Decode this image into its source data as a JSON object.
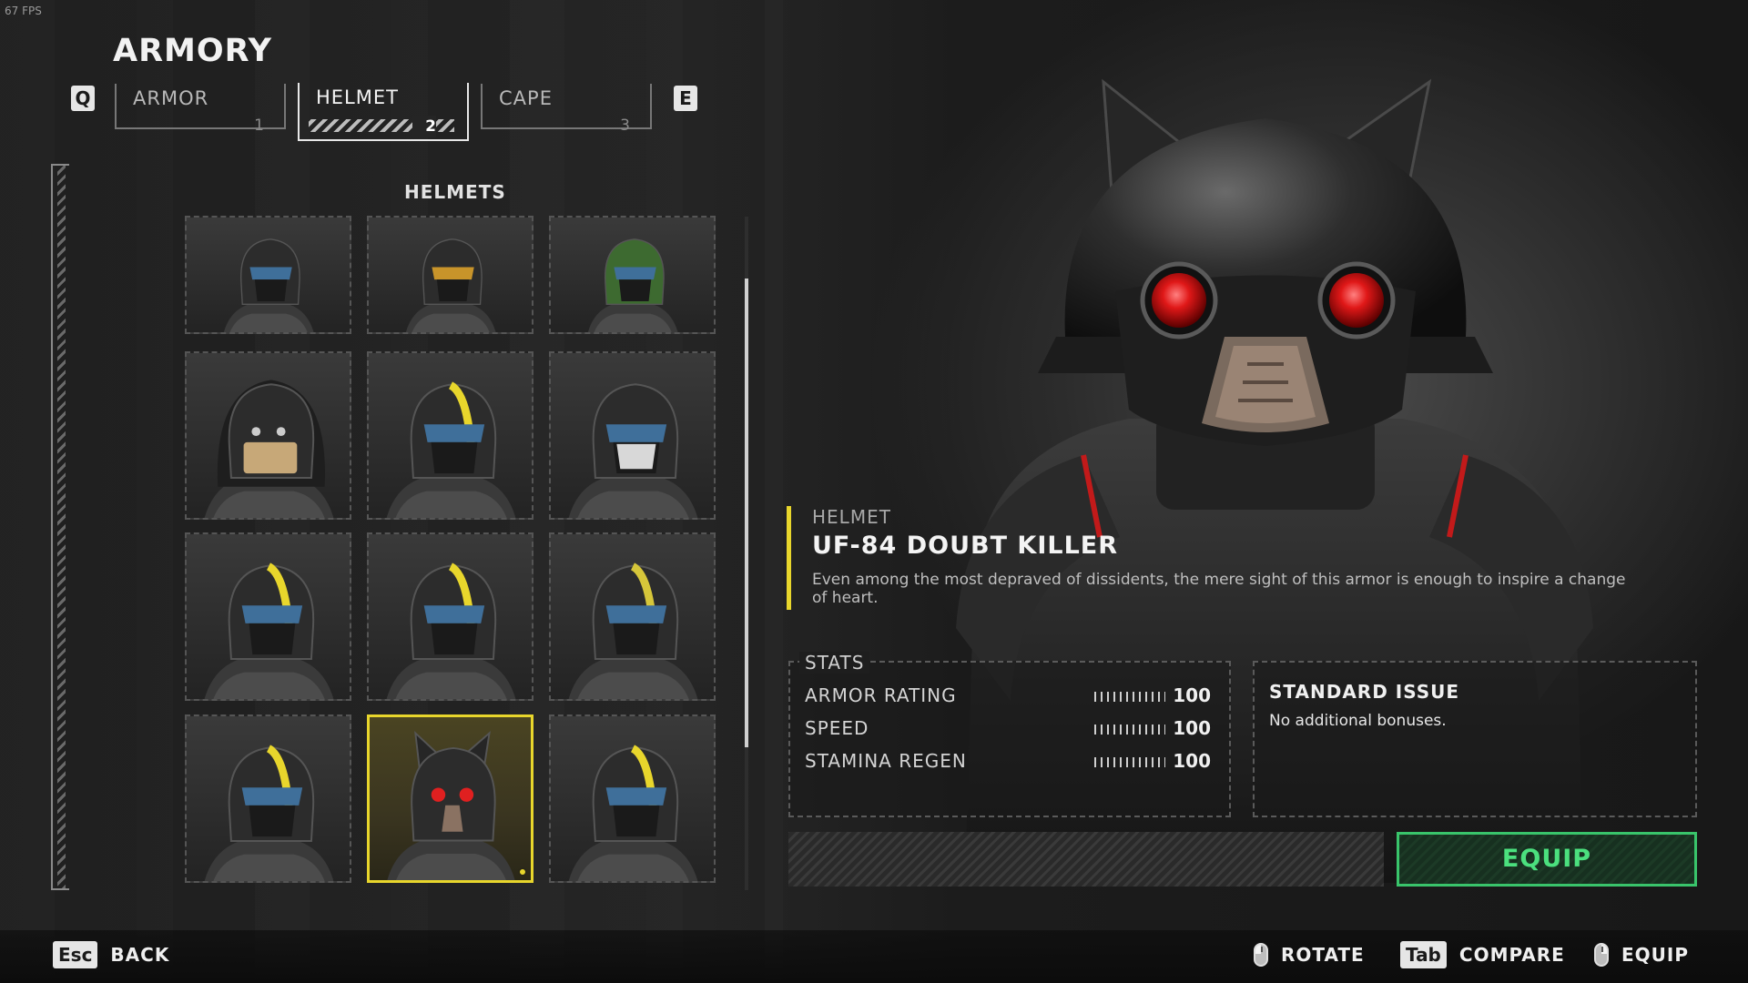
{
  "hud": {
    "fps": "67 FPS"
  },
  "header": {
    "title": "ARMORY"
  },
  "keys": {
    "prev_tab": "Q",
    "next_tab": "E"
  },
  "tabs": [
    {
      "label": "ARMOR",
      "number": "1",
      "active": false
    },
    {
      "label": "HELMET",
      "number": "2",
      "active": true
    },
    {
      "label": "CAPE",
      "number": "3",
      "active": false
    }
  ],
  "grid": {
    "heading": "HELMETS",
    "scroll_position": 0.3,
    "items": [
      {
        "icon": "helmet-black-visor-icon",
        "accent": "#2a3a4a",
        "selected": false
      },
      {
        "icon": "helmet-gold-visor-icon",
        "accent": "#c8942a",
        "selected": false
      },
      {
        "icon": "helmet-green-icon",
        "accent": "#4e8a3c",
        "selected": false
      },
      {
        "icon": "helmet-hooded-icon",
        "accent": "#c7a878",
        "selected": false
      },
      {
        "icon": "helmet-yellow-crest-icon",
        "accent": "#e8d62c",
        "selected": false
      },
      {
        "icon": "helmet-white-mask-icon",
        "accent": "#d8d8d8",
        "selected": false
      },
      {
        "icon": "helmet-yellow-stripe-icon",
        "accent": "#e8d62c",
        "selected": false
      },
      {
        "icon": "helmet-yellow-stripe-icon",
        "accent": "#e8d62c",
        "selected": false
      },
      {
        "icon": "helmet-dark-stripe-icon",
        "accent": "#d6c63a",
        "selected": false
      },
      {
        "icon": "helmet-yellow-stripe-icon",
        "accent": "#e8d62c",
        "selected": false
      },
      {
        "icon": "helmet-cat-ears-icon",
        "accent": "#e02020",
        "selected": true
      },
      {
        "icon": "helmet-knight-icon",
        "accent": "#e8d62c",
        "selected": false
      }
    ]
  },
  "item": {
    "category": "HELMET",
    "name": "UF-84 DOUBT KILLER",
    "description": "Even among the most depraved of dissidents, the mere sight of this armor is enough to inspire a change of heart."
  },
  "stats": {
    "title": "STATS",
    "rows": [
      {
        "name": "ARMOR RATING",
        "value": "100"
      },
      {
        "name": "SPEED",
        "value": "100"
      },
      {
        "name": "STAMINA REGEN",
        "value": "100"
      }
    ]
  },
  "passive": {
    "title": "STANDARD ISSUE",
    "description": "No additional bonuses."
  },
  "actions": {
    "equip_label": "EQUIP"
  },
  "footer": {
    "back_key": "Esc",
    "back_label": "BACK",
    "rotate_label": "ROTATE",
    "compare_key": "Tab",
    "compare_label": "COMPARE",
    "equip_label": "EQUIP"
  },
  "colors": {
    "accent_yellow": "#e8d62c",
    "equip_green": "#39c46b",
    "eye_red": "#e02020"
  }
}
